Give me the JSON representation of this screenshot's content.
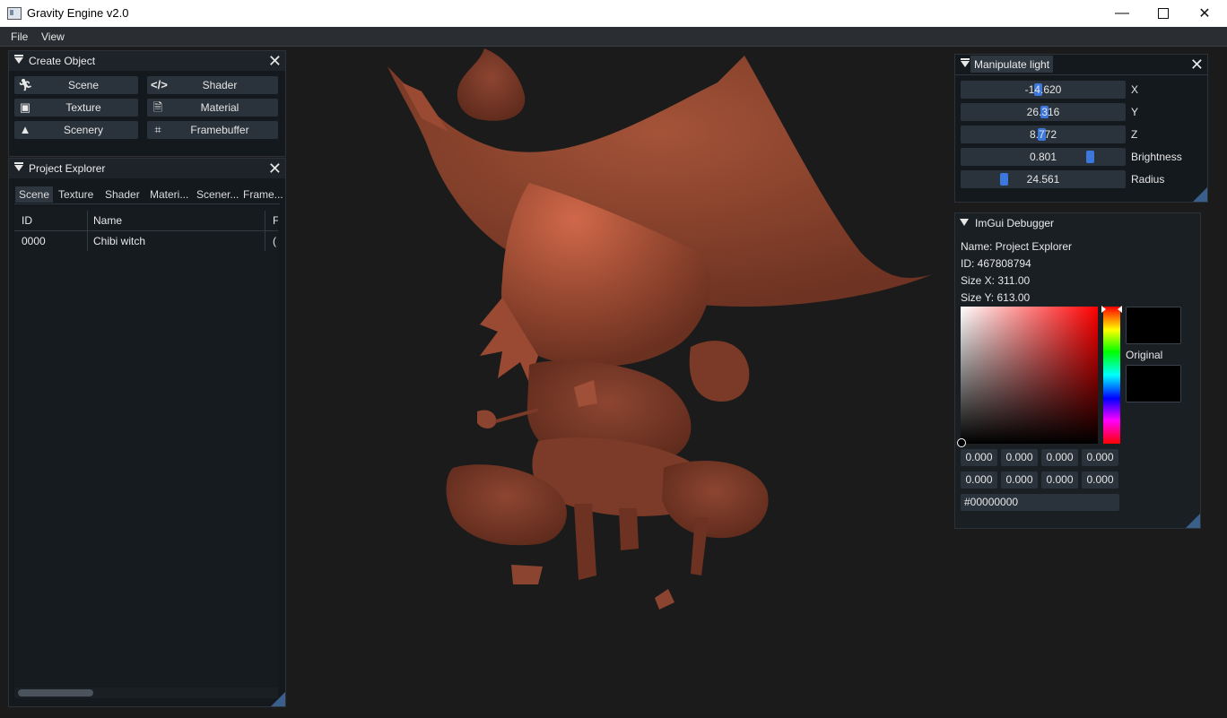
{
  "window": {
    "title": "Gravity Engine v2.0"
  },
  "menu": {
    "file": "File",
    "view": "View"
  },
  "create_object": {
    "title": "Create Object",
    "buttons": [
      {
        "label": "Scene",
        "icon": "running-person-icon"
      },
      {
        "label": "Shader",
        "icon": "code-icon"
      },
      {
        "label": "Texture",
        "icon": "image-icon"
      },
      {
        "label": "Material",
        "icon": "file-code-icon"
      },
      {
        "label": "Scenery",
        "icon": "tree-icon"
      },
      {
        "label": "Framebuffer",
        "icon": "crop-icon"
      }
    ]
  },
  "project_explorer": {
    "title": "Project Explorer",
    "tabs": [
      "Scene",
      "Texture",
      "Shader",
      "Materi...",
      "Scener...",
      "Frame..."
    ],
    "columns": [
      "ID",
      "Name",
      "F"
    ],
    "rows": [
      {
        "id": "0000",
        "name": "Chibi witch",
        "extra": "("
      }
    ]
  },
  "manipulate_light": {
    "title": "Manipulate light",
    "sliders": [
      {
        "label": "X",
        "value": "-14.620",
        "fraction": 0.47
      },
      {
        "label": "Y",
        "value": "26.316",
        "fraction": 0.51
      },
      {
        "label": "Z",
        "value": "8.772",
        "fraction": 0.49
      },
      {
        "label": "Brightness",
        "value": "0.801",
        "fraction": 0.8
      },
      {
        "label": "Radius",
        "value": "24.561",
        "fraction": 0.25
      }
    ]
  },
  "debugger": {
    "title": "ImGui Debugger",
    "name_line": "Name: Project Explorer",
    "id_line": "ID: 467808794",
    "size_x_line": "Size X: 311.00",
    "size_y_line": "Size Y: 613.00",
    "original_label": "Original",
    "row1": [
      "0.000",
      "0.000",
      "0.000",
      "0.000"
    ],
    "row2": [
      "0.000",
      "0.000",
      "0.000",
      "0.000"
    ],
    "hex": "#00000000",
    "current_color": "#000000"
  },
  "colors": {
    "accent": "#3d7ef0",
    "model": "#8a4430",
    "panel_bg": "#14191e"
  }
}
